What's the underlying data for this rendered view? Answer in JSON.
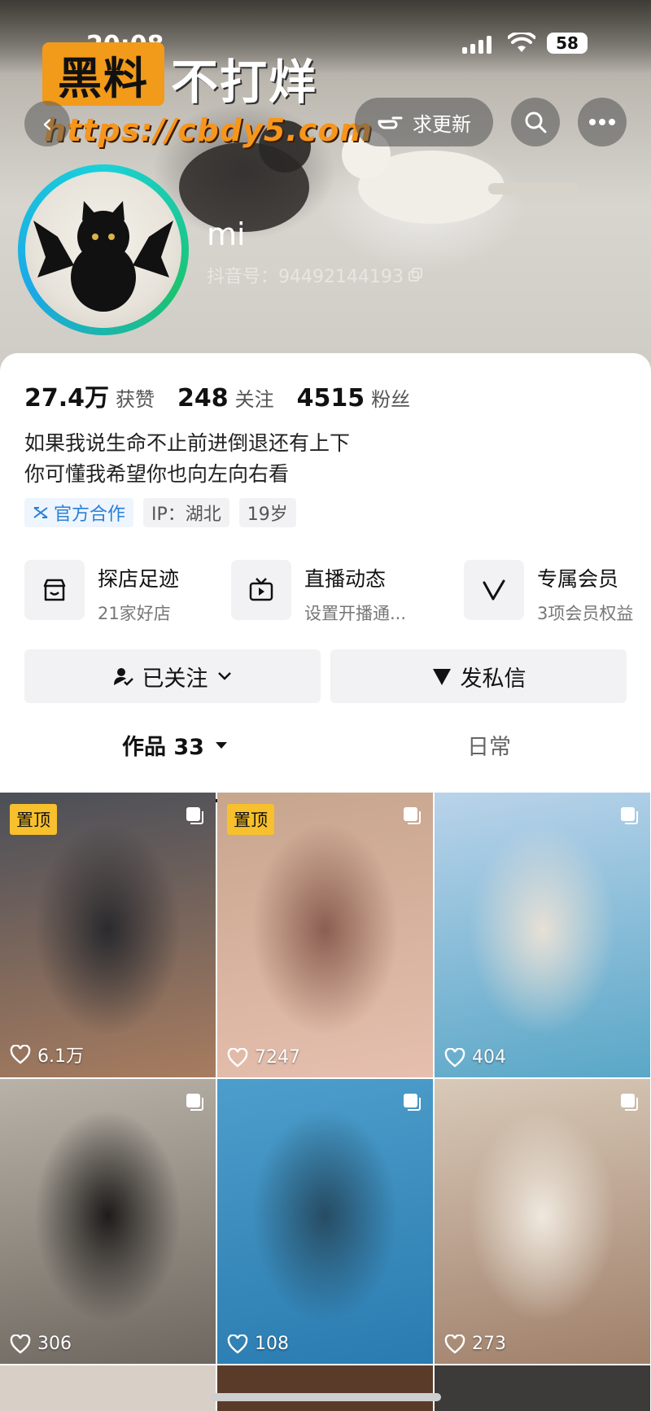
{
  "status_bar": {
    "time": "20:08",
    "battery": "58"
  },
  "watermark": {
    "box_text": "黑料",
    "text": "不打烊",
    "url": "https://cbdy5.com"
  },
  "header": {
    "update_label": "求更新"
  },
  "profile": {
    "username": "mi",
    "douyin_id": "抖音号：94492144193",
    "stats": [
      {
        "value": "27.4万",
        "label": "获赞"
      },
      {
        "value": "248",
        "label": "关注"
      },
      {
        "value": "4515",
        "label": "粉丝"
      }
    ],
    "bio_lines": [
      "如果我说生命不止前进倒退还有上下",
      "你可懂我希望你也向左向右看"
    ],
    "tags": [
      "官方合作",
      "IP：湖北",
      "19岁"
    ]
  },
  "features": [
    {
      "title": "探店足迹",
      "subtitle": "21家好店",
      "icon": "store-icon"
    },
    {
      "title": "直播动态",
      "subtitle": "设置开播通...",
      "icon": "tv-icon"
    },
    {
      "title": "专属会员",
      "subtitle": "3项会员权益",
      "icon": "vip-icon"
    }
  ],
  "actions": {
    "follow_label": "已关注",
    "message_label": "发私信"
  },
  "tabs": {
    "works": "作品 33",
    "daily": "日常"
  },
  "grid": {
    "pinned_label": "置顶",
    "tiles": [
      {
        "likes": "6.1万",
        "pinned": true,
        "colors": [
          "#4b4f58",
          "#a77c5f",
          "#2a2a2e"
        ]
      },
      {
        "likes": "7247",
        "pinned": true,
        "colors": [
          "#c7a58d",
          "#e6bfae",
          "#8b5f52"
        ]
      },
      {
        "likes": "404",
        "pinned": false,
        "colors": [
          "#b9d3ea",
          "#5aa7c7",
          "#e7e0d6"
        ]
      },
      {
        "likes": "306",
        "pinned": false,
        "colors": [
          "#b8b2a8",
          "#6d675f",
          "#1e1b1a"
        ]
      },
      {
        "likes": "108",
        "pinned": false,
        "colors": [
          "#4d9ecb",
          "#2a7bb0",
          "#264c63"
        ]
      },
      {
        "likes": "273",
        "pinned": false,
        "colors": [
          "#d8c9b8",
          "#a0806a",
          "#efe8de"
        ]
      }
    ]
  }
}
